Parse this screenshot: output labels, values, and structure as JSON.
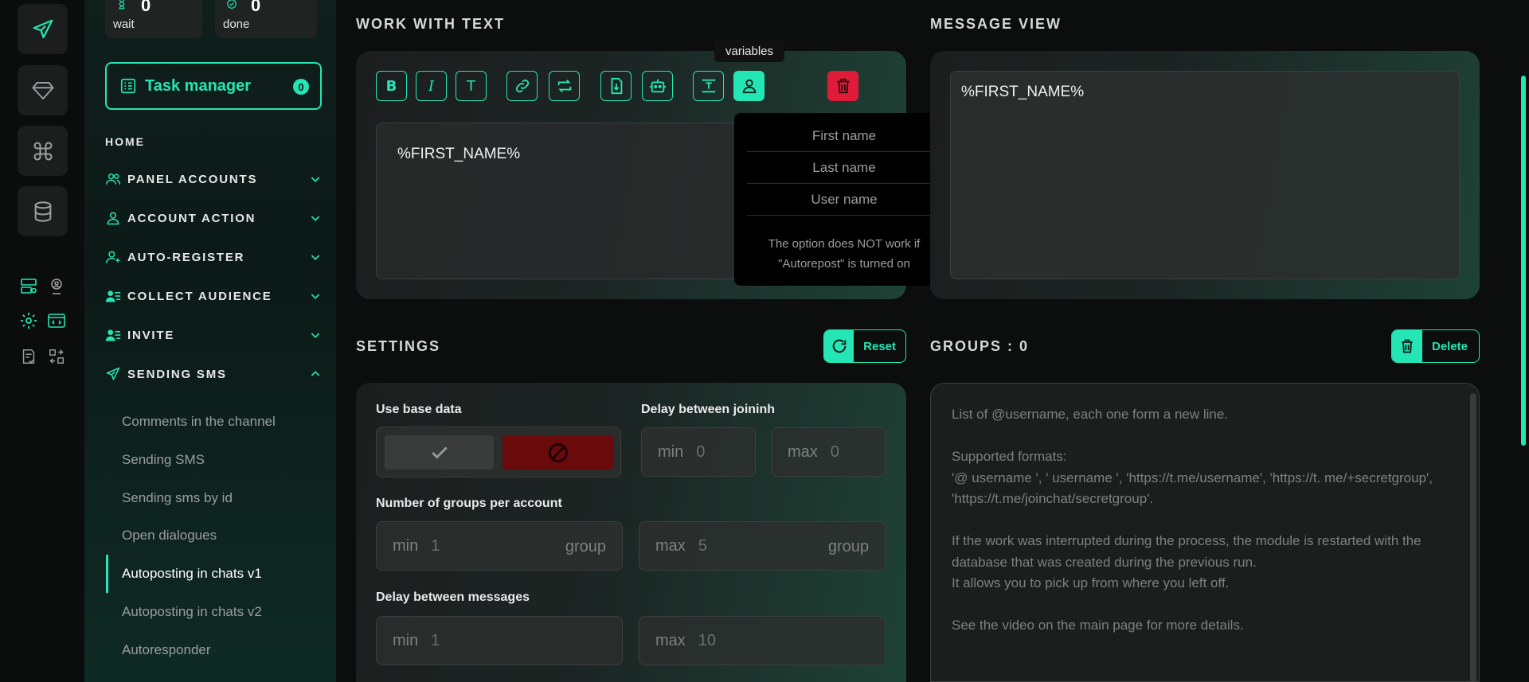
{
  "colors": {
    "accent": "#24e6b4",
    "danger": "#e01b3a",
    "background": "#0c0d0d"
  },
  "stats": {
    "wait": {
      "count": "0",
      "label": "wait",
      "icon": "hourglass-icon"
    },
    "done": {
      "count": "0",
      "label": "done",
      "icon": "check-circle-icon"
    }
  },
  "task_manager": {
    "label": "Task manager",
    "count": "0"
  },
  "nav": {
    "home": "HOME",
    "sections": [
      {
        "label": "PANEL ACCOUNTS",
        "icon": "users-icon"
      },
      {
        "label": "ACCOUNT ACTION",
        "icon": "user-icon"
      },
      {
        "label": "AUTO-REGISTER",
        "icon": "user-plus-icon"
      },
      {
        "label": "COLLECT AUDIENCE",
        "icon": "user-list-icon"
      },
      {
        "label": "INVITE",
        "icon": "user-list-icon"
      },
      {
        "label": "SENDING SMS",
        "icon": "send-icon"
      }
    ],
    "sub_items": [
      "Comments in the channel",
      "Sending SMS",
      "Sending sms by id",
      "Open dialogues",
      "Autoposting in chats v1",
      "Autoposting in chats v2",
      "Autoresponder"
    ],
    "active_sub_item": "Autoposting in chats v1"
  },
  "work_with_text": {
    "title": "WORK WITH TEXT",
    "toolbar": {
      "bold": "B",
      "italic": "I",
      "text": "T",
      "variables_tooltip": "variables"
    },
    "content": "%FIRST_NAME%",
    "variables_menu": {
      "options": [
        "First name",
        "Last name",
        "User name"
      ],
      "note": "The option does NOT work if \"Autorepost\" is turned on"
    }
  },
  "message_view": {
    "title": "MESSAGE VIEW",
    "content": "%FIRST_NAME%"
  },
  "settings": {
    "title": "SETTINGS",
    "reset_label": "Reset",
    "use_base_data": "Use base data",
    "delay_joining": {
      "label": "Delay between joininh",
      "min_prefix": "min",
      "min_value": "0",
      "max_prefix": "max",
      "max_value": "0"
    },
    "groups_per_account": {
      "label": "Number of groups per account",
      "min_prefix": "min",
      "min_value": "1",
      "min_suffix": "group",
      "max_prefix": "max",
      "max_value": "5",
      "max_suffix": "group"
    },
    "delay_messages": {
      "label": "Delay between messages",
      "min_prefix": "min",
      "min_value": "1",
      "max_prefix": "max",
      "max_value": "10"
    }
  },
  "groups": {
    "title": "GROUPS : 0",
    "delete_label": "Delete",
    "placeholder": "List of @username, each one form a new line.\n\nSupported formats:\n'@ username ', ' username ', 'https://t.me/username', 'https://t. me/+secretgroup', 'https://t.me/joinchat/secretgroup'.\n\nIf the work was interrupted during the process, the module is restarted with the database that was created during the previous run.\nIt allows you to pick up from where you left off.\n\nSee the video on the main page for more details."
  }
}
